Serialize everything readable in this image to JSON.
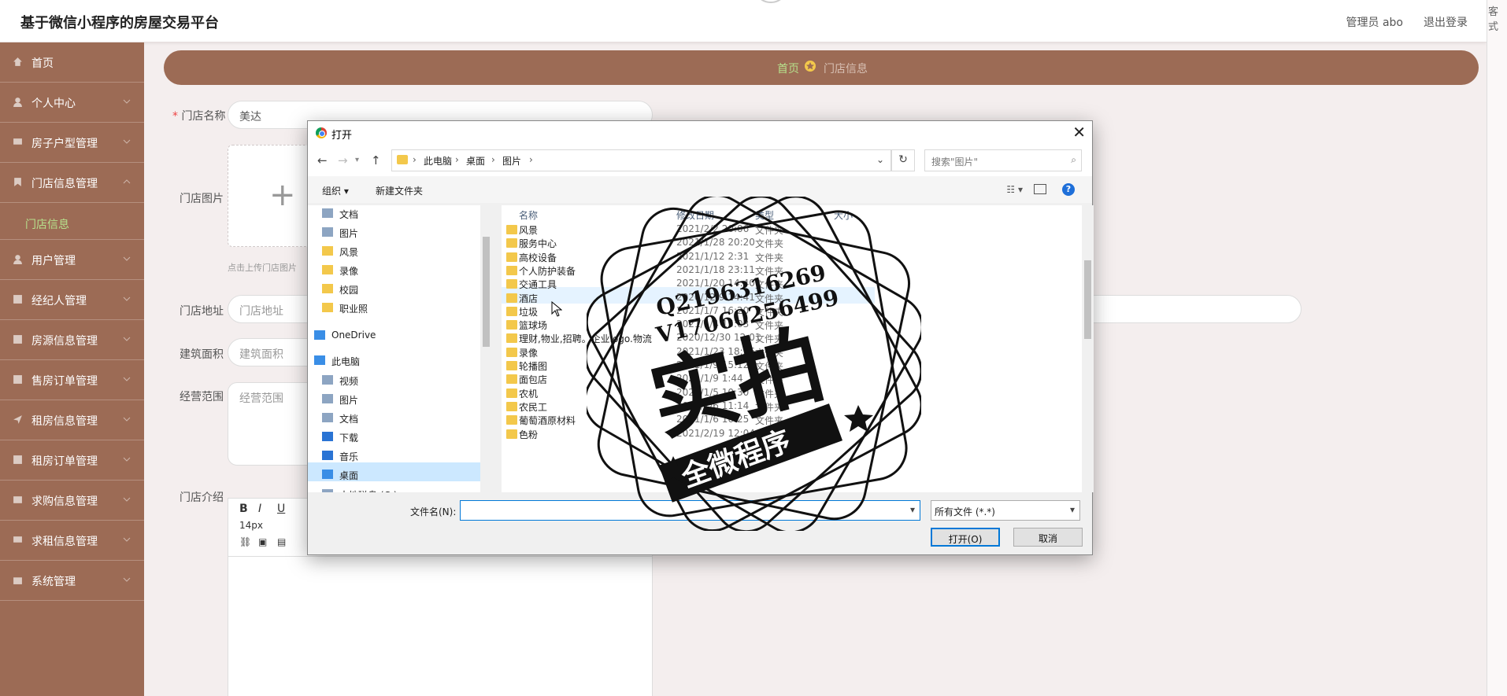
{
  "header": {
    "title": "基于微信小程序的房屋交易平台",
    "user": "管理员 abo",
    "logout": "退出登录",
    "edge_text": "客式"
  },
  "sidebar": {
    "items": [
      {
        "label": "首页",
        "icon": "home-icon"
      },
      {
        "label": "个人中心",
        "icon": "user-icon"
      },
      {
        "label": "房子户型管理",
        "icon": "monitor-icon"
      },
      {
        "label": "门店信息管理",
        "icon": "bookmark-icon"
      },
      {
        "label": "用户管理",
        "icon": "user-icon"
      },
      {
        "label": "经纪人管理",
        "icon": "grid-icon"
      },
      {
        "label": "房源信息管理",
        "icon": "grid-icon"
      },
      {
        "label": "售房订单管理",
        "icon": "grid-icon"
      },
      {
        "label": "租房信息管理",
        "icon": "send-icon"
      },
      {
        "label": "租房订单管理",
        "icon": "grid-icon"
      },
      {
        "label": "求购信息管理",
        "icon": "mail-icon"
      },
      {
        "label": "求租信息管理",
        "icon": "chat-icon"
      },
      {
        "label": "系统管理",
        "icon": "briefcase-icon"
      }
    ],
    "sub_item": "门店信息"
  },
  "breadcrumb": {
    "home": "首页",
    "current": "门店信息"
  },
  "form": {
    "store_name_label": "门店名称",
    "store_name_value": "美达",
    "store_image_label": "门店图片",
    "upload_hint": "点击上传门店图片",
    "address_label": "门店地址",
    "address_placeholder": "门店地址",
    "area_label": "建筑面积",
    "area_placeholder": "建筑面积",
    "scope_label": "经营范围",
    "scope_placeholder": "经营范围",
    "intro_label": "门店介绍",
    "editor_font_size": "14px"
  },
  "dialog": {
    "title": "打开",
    "path": [
      "此电脑",
      "桌面",
      "图片"
    ],
    "search_placeholder": "搜索\"图片\"",
    "organize": "组织",
    "new_folder": "新建文件夹",
    "nav_items": [
      "文档",
      "图片",
      "风景",
      "录像",
      "校园",
      "职业照",
      "OneDrive",
      "此电脑",
      "视频",
      "图片",
      "文档",
      "下载",
      "音乐",
      "桌面",
      "本地磁盘 (C:)"
    ],
    "columns": {
      "name": "名称",
      "date": "修改日期",
      "type": "类型",
      "size": "大小"
    },
    "files": [
      {
        "name": "风景",
        "date": "2021/2/2 20:06",
        "type": "文件夹"
      },
      {
        "name": "服务中心",
        "date": "2021/1/28 20:20",
        "type": "文件夹"
      },
      {
        "name": "高校设备",
        "date": "2021/1/12 2:31",
        "type": "文件夹"
      },
      {
        "name": "个人防护装备",
        "date": "2021/1/18 23:11",
        "type": "文件夹"
      },
      {
        "name": "交通工具",
        "date": "2021/1/20 14:40",
        "type": "文件夹"
      },
      {
        "name": "酒店",
        "date": "2020/12/9 14:41",
        "type": "文件夹"
      },
      {
        "name": "垃圾",
        "date": "2021/1/7 16:20",
        "type": "文件夹"
      },
      {
        "name": "篮球场",
        "date": "2021/1/4 15:03",
        "type": "文件夹"
      },
      {
        "name": "理财,物业,招聘。企业logo.物流",
        "date": "2020/12/30 12:01",
        "type": "文件夹"
      },
      {
        "name": "录像",
        "date": "2021/1/23 18:36",
        "type": "文件夹"
      },
      {
        "name": "轮播图",
        "date": "2021/1/9 15:12",
        "type": "文件夹"
      },
      {
        "name": "面包店",
        "date": "2021/1/9 1:44",
        "type": "文件夹"
      },
      {
        "name": "农机",
        "date": "2021/1/5 10:30",
        "type": "文件夹"
      },
      {
        "name": "农民工",
        "date": "2021/1/6 11:14",
        "type": "文件夹"
      },
      {
        "name": "葡萄酒原材料",
        "date": "2021/1/6 16:25",
        "type": "文件夹"
      },
      {
        "name": "色粉",
        "date": "2021/2/19 12:04",
        "type": "文件夹"
      }
    ],
    "filename_label": "文件名(N):",
    "filetype": "所有文件 (*.*)",
    "open_button": "打开(O)",
    "cancel_button": "取消"
  },
  "watermark": {
    "line1": "Q2196316269",
    "line2": "V17060256499",
    "main": "实拍",
    "ribbon": "全微程序"
  }
}
